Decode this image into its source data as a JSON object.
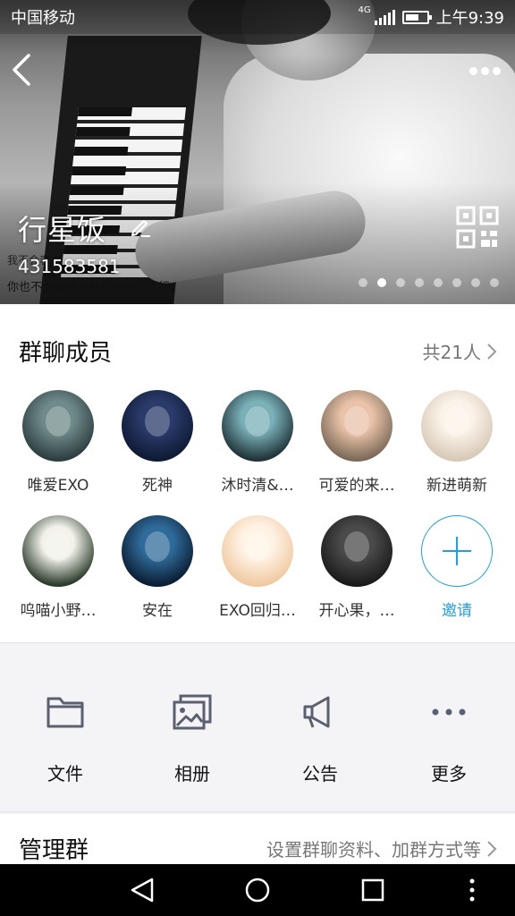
{
  "status_bar": {
    "carrier": "中国移动",
    "network": "4G",
    "time": "上午9:39"
  },
  "header": {
    "group_name": "行星饭",
    "group_id": "431583581",
    "photo_text_line1": "我不会表白",
    "photo_text_line2": "你也不会爱我，我们也注定平行。",
    "carousel_pages": 8,
    "carousel_active": 2
  },
  "members": {
    "title": "群聊成员",
    "count_label": "共21人",
    "list": [
      {
        "name": "唯爱EXO",
        "colors": [
          "#6f8a8a",
          "#2e3e40"
        ]
      },
      {
        "name": "死神",
        "colors": [
          "#2a3a6a",
          "#0f1a34"
        ]
      },
      {
        "name": "沐时清&…",
        "colors": [
          "#7ab0b8",
          "#1f3338"
        ]
      },
      {
        "name": "可爱的来…",
        "colors": [
          "#e9c2a8",
          "#7c6a58"
        ]
      },
      {
        "name": "新进萌新",
        "colors": [
          "#fbf3e9",
          "#d8c9b8"
        ]
      },
      {
        "name": "呜喵小野…",
        "colors": [
          "#f2f2ea",
          "#2b3b2b"
        ]
      },
      {
        "name": "安在",
        "colors": [
          "#2f6b9a",
          "#0b1d33"
        ]
      },
      {
        "name": "EXO回归…",
        "colors": [
          "#fff3e6",
          "#f0c9a0"
        ]
      },
      {
        "name": "开心果，…",
        "colors": [
          "#4a4a4a",
          "#1a1a1a"
        ]
      }
    ],
    "invite_label": "邀请",
    "accent_color": "#20a0e0"
  },
  "tools": [
    {
      "label": "文件",
      "icon": "folder-icon"
    },
    {
      "label": "相册",
      "icon": "album-icon"
    },
    {
      "label": "公告",
      "icon": "megaphone-icon"
    },
    {
      "label": "更多",
      "icon": "more-dots-icon"
    }
  ],
  "manage": {
    "title": "管理群",
    "detail": "设置群聊资料、加群方式等"
  }
}
